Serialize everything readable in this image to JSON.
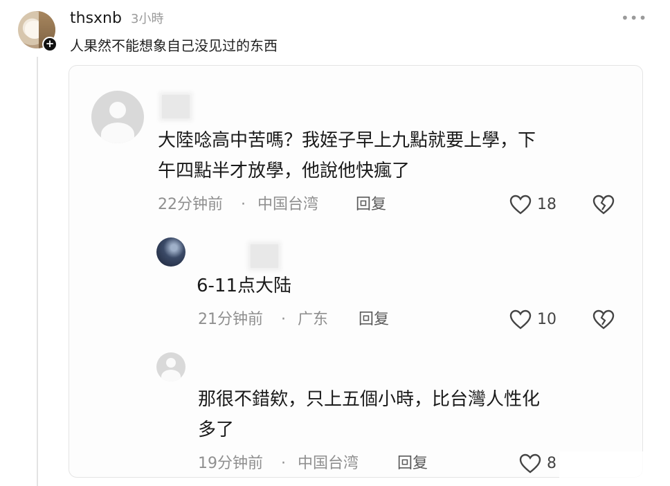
{
  "post": {
    "username": "thsxnb",
    "time": "3小時",
    "more": "•••",
    "caption": "人果然不能想象自己没见过的东西"
  },
  "comments": [
    {
      "text_line1": "大陸唸高中苦嗎？我姪子早上九點就要上學，下",
      "text_line2": "午四點半才放學，他說他快瘋了",
      "time": "22分钟前",
      "location": "中国台湾",
      "reply_label": "回复",
      "likes": "18"
    },
    {
      "text_line1": "6-11点大陆",
      "time": "21分钟前",
      "location": "广东",
      "reply_label": "回复",
      "likes": "10"
    },
    {
      "text_line1": "那很不錯欸，只上五個小時，比台灣人性化",
      "text_line2": "多了",
      "time": "19分钟前",
      "location": "中国台湾",
      "reply_label": "回复",
      "likes": "8"
    }
  ],
  "meta_separator": "·",
  "icons": {
    "like": "heart-outline-icon",
    "dislike": "broken-heart-icon",
    "follow": "plus-icon",
    "more": "more-dots-icon"
  },
  "colors": {
    "text": "#1a1a1a",
    "muted": "#8f8f8f",
    "card_border": "#e4e4e4"
  }
}
